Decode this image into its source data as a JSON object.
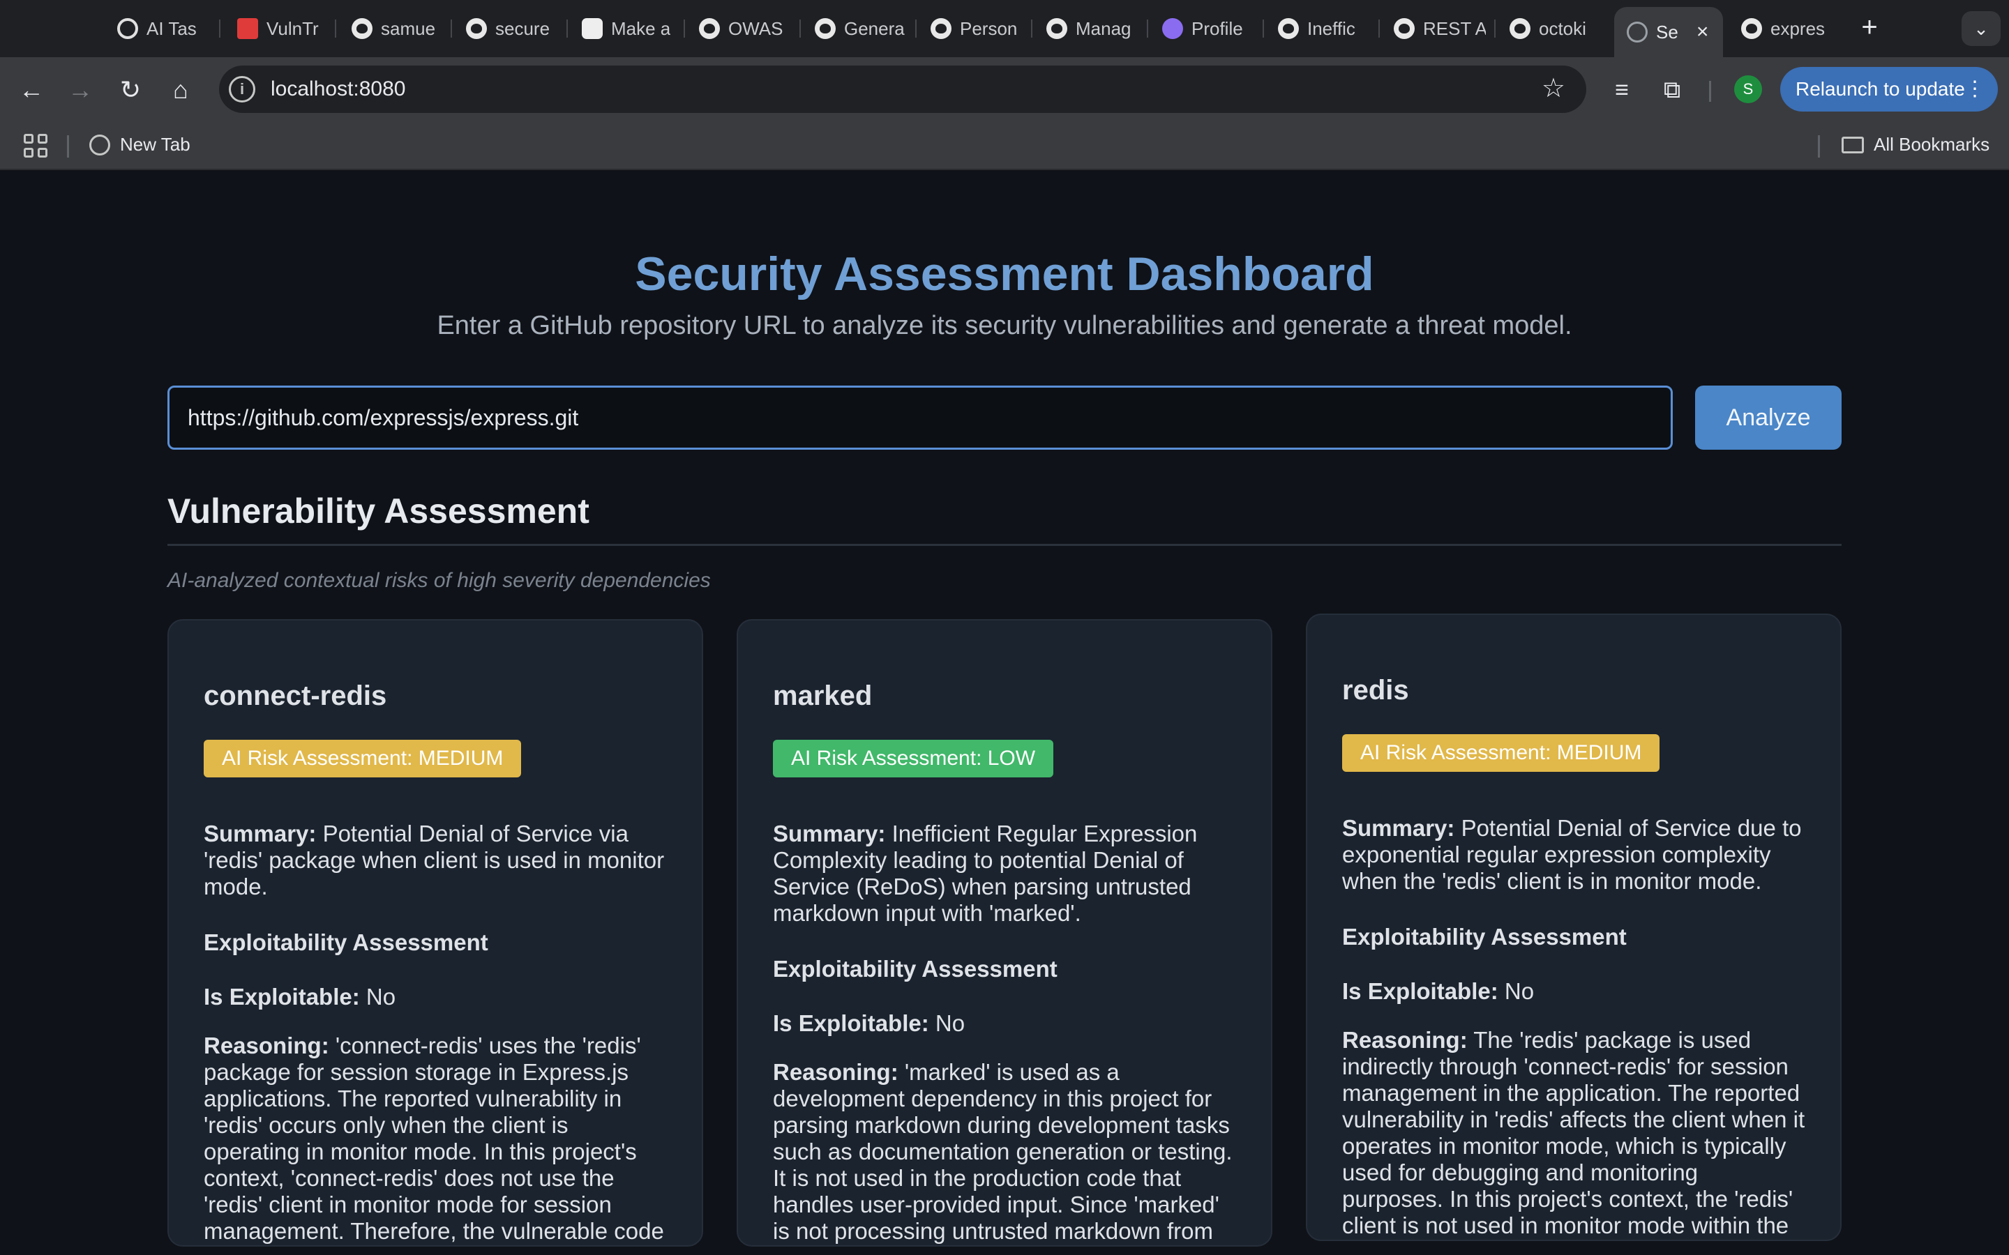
{
  "browser": {
    "tabs": [
      {
        "label": "AI Tas",
        "icon": "openai-icon"
      },
      {
        "label": "VulnTr",
        "icon": "vulntrack-icon"
      },
      {
        "label": "samue",
        "icon": "github-icon"
      },
      {
        "label": "secure",
        "icon": "github-icon"
      },
      {
        "label": "Make a",
        "icon": "message-icon"
      },
      {
        "label": "OWAS",
        "icon": "github-icon"
      },
      {
        "label": "Genera",
        "icon": "github-icon"
      },
      {
        "label": "Person",
        "icon": "github-icon"
      },
      {
        "label": "Manag",
        "icon": "github-icon"
      },
      {
        "label": "Profile",
        "icon": "profile-icon"
      },
      {
        "label": "Ineffic",
        "icon": "github-icon"
      },
      {
        "label": "REST A",
        "icon": "github-icon"
      },
      {
        "label": "octoki",
        "icon": "github-icon"
      },
      {
        "label": "Se",
        "icon": "globe-icon"
      },
      {
        "label": "expres",
        "icon": "github-icon"
      }
    ],
    "url": "localhost:8080",
    "profile_initial": "S",
    "relaunch_label": "Relaunch to update",
    "bookmarks": {
      "new_tab": "New Tab",
      "all_bookmarks": "All Bookmarks"
    }
  },
  "page": {
    "title": "Security Assessment Dashboard",
    "subtitle": "Enter a GitHub repository URL to analyze its security vulnerabilities and generate a threat model.",
    "repo_input_value": "https://github.com/expressjs/express.git",
    "analyze_label": "Analyze",
    "section_title": "Vulnerability Assessment",
    "section_subtitle": "AI-analyzed contextual risks of high severity dependencies",
    "labels": {
      "summary": "Summary:",
      "exploitability": "Exploitability Assessment",
      "is_exploitable": "Is Exploitable:",
      "reasoning": "Reasoning:"
    },
    "cards": [
      {
        "name": "connect-redis",
        "risk": "AI Risk Assessment: MEDIUM",
        "risk_color": "#e1b84a",
        "summary": "Potential Denial of Service via 'redis' package when client is used in monitor mode.",
        "is_exploitable": "No",
        "reasoning": "'connect-redis' uses the 'redis' package for session storage in Express.js applications. The reported vulnerability in 'redis' occurs only when the client is operating in monitor mode. In this project's context, 'connect-redis' does not use the 'redis' client in monitor mode for session management. Therefore, the vulnerable code path is not reachable through 'connect-redis'"
      },
      {
        "name": "marked",
        "risk": "AI Risk Assessment: LOW",
        "risk_color": "#41b86a",
        "summary": "Inefficient Regular Expression Complexity leading to potential Denial of Service (ReDoS) when parsing untrusted markdown input with 'marked'.",
        "is_exploitable": "No",
        "reasoning": "'marked' is used as a development dependency in this project for parsing markdown during development tasks such as documentation generation or testing. It is not used in the production code that handles user-provided input. Since 'marked' is not processing untrusted markdown from external users in the production environment"
      },
      {
        "name": "redis",
        "risk": "AI Risk Assessment: MEDIUM",
        "risk_color": "#e1b84a",
        "summary": "Potential Denial of Service due to exponential regular expression complexity when the 'redis' client is in monitor mode.",
        "is_exploitable": "No",
        "reasoning": "The 'redis' package is used indirectly through 'connect-redis' for session management in the application. The reported vulnerability in 'redis' affects the client when it operates in monitor mode, which is typically used for debugging and monitoring purposes. In this project's context, the 'redis' client is not used in monitor mode within the production environment. Therefore, the"
      }
    ]
  }
}
